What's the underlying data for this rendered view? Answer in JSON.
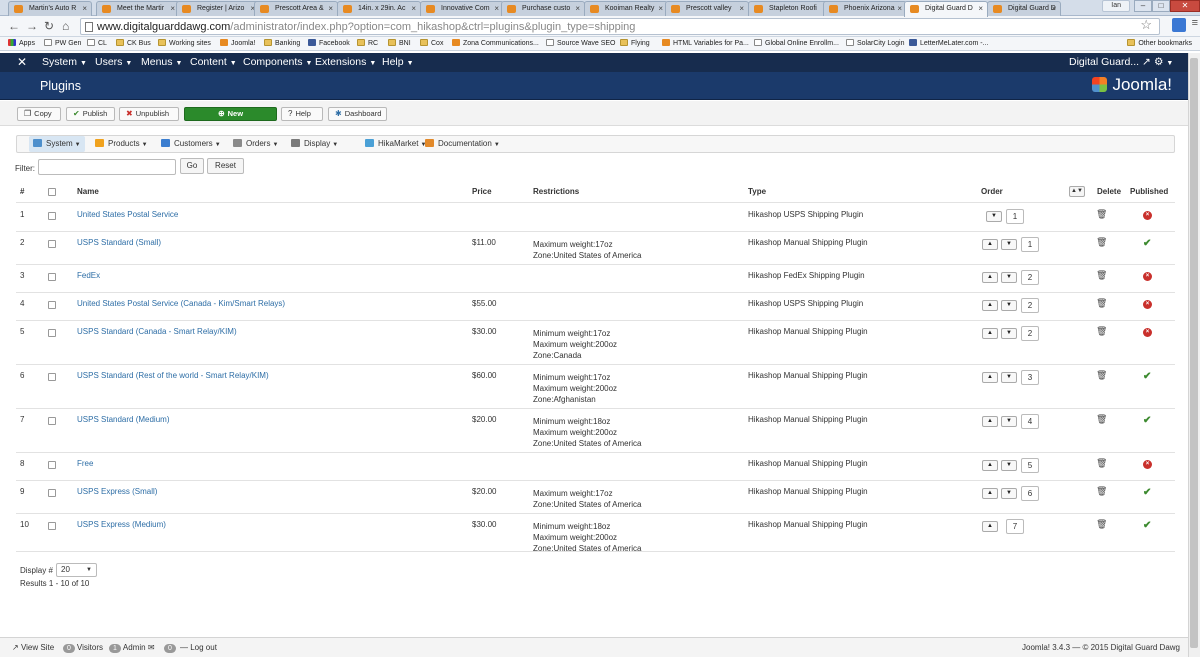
{
  "browser": {
    "tabs": [
      {
        "label": "Martin's Auto R"
      },
      {
        "label": "Meet the Martir"
      },
      {
        "label": "Register | Arizo"
      },
      {
        "label": "Prescott Area &"
      },
      {
        "label": "14in. x 29in. Ac"
      },
      {
        "label": "Innovative Com"
      },
      {
        "label": "Purchase custo"
      },
      {
        "label": "Kooiman Realty"
      },
      {
        "label": "Prescott valley"
      },
      {
        "label": "Stapleton Roofi"
      },
      {
        "label": "Phoenix Arizona"
      },
      {
        "label": "Digital Guard D"
      },
      {
        "label": "Digital Guard D"
      }
    ],
    "user": "Ian",
    "url_host": "www.digitalguarddawg.com",
    "url_path": "/administrator/index.php?option=com_hikashop&ctrl=plugins&plugin_type=shipping",
    "bookmarks": [
      {
        "label": "Apps",
        "icon": "apps-icon"
      },
      {
        "label": "PW Gen",
        "icon": "page-icon"
      },
      {
        "label": "CL",
        "icon": "peace-icon"
      },
      {
        "label": "CK Bus",
        "icon": "folder-icon"
      },
      {
        "label": "Working sites",
        "icon": "folder-icon"
      },
      {
        "label": "Joomla!",
        "icon": "joomla-icon"
      },
      {
        "label": "Banking",
        "icon": "folder-icon"
      },
      {
        "label": "Facebook",
        "icon": "facebook-icon"
      },
      {
        "label": "RC",
        "icon": "folder-icon"
      },
      {
        "label": "BNI",
        "icon": "folder-icon"
      },
      {
        "label": "Cox",
        "icon": "folder-icon"
      },
      {
        "label": "Zona Communications...",
        "icon": "zona-icon"
      },
      {
        "label": "Source Wave SEO",
        "icon": "page-icon"
      },
      {
        "label": "Flying",
        "icon": "folder-icon"
      },
      {
        "label": "HTML Variables for Pa...",
        "icon": "hikashop-icon"
      },
      {
        "label": "Global Online Enrollm...",
        "icon": "page-icon"
      },
      {
        "label": "SolarCity Login",
        "icon": "page-icon"
      },
      {
        "label": "LetterMeLater.com -...",
        "icon": "lml-icon"
      }
    ],
    "other_bookmarks": "Other bookmarks"
  },
  "admin_nav": {
    "items": [
      "System",
      "Users",
      "Menus",
      "Content",
      "Components",
      "Extensions",
      "Help"
    ],
    "site_name": "Digital Guard...",
    "brand": "Joomla!"
  },
  "page_title": "Plugins",
  "toolbar": {
    "copy": "Copy",
    "publish": "Publish",
    "unpublish": "Unpublish",
    "new": "New",
    "help": "Help",
    "dashboard": "Dashboard"
  },
  "hika_menu": [
    "System",
    "Products",
    "Customers",
    "Orders",
    "Display",
    "HikaMarket",
    "Documentation"
  ],
  "filter": {
    "label": "Filter:",
    "value": "",
    "go": "Go",
    "reset": "Reset"
  },
  "table": {
    "headers": {
      "num": "#",
      "name": "Name",
      "price": "Price",
      "restrictions": "Restrictions",
      "type": "Type",
      "order": "Order",
      "delete": "Delete",
      "published": "Published"
    },
    "rows": [
      {
        "num": "1",
        "name": "United States Postal Service",
        "price": "",
        "restrictions": [],
        "type": "Hikashop USPS Shipping Plugin",
        "order": "1",
        "published": false
      },
      {
        "num": "2",
        "name": "USPS Standard (Small)",
        "price": "$11.00",
        "restrictions": [
          "Maximum weight:17oz",
          "Zone:United States of America"
        ],
        "type": "Hikashop Manual Shipping Plugin",
        "order": "1",
        "published": true
      },
      {
        "num": "3",
        "name": "FedEx",
        "price": "",
        "restrictions": [],
        "type": "Hikashop FedEx Shipping Plugin",
        "order": "2",
        "published": false
      },
      {
        "num": "4",
        "name": "United States Postal Service (Canada - Kim/Smart Relays)",
        "price": "$55.00",
        "restrictions": [],
        "type": "Hikashop USPS Shipping Plugin",
        "order": "2",
        "published": false
      },
      {
        "num": "5",
        "name": "USPS Standard (Canada - Smart Relay/KIM)",
        "price": "$30.00",
        "restrictions": [
          "Minimum weight:17oz",
          "Maximum weight:200oz",
          "Zone:Canada"
        ],
        "type": "Hikashop Manual Shipping Plugin",
        "order": "2",
        "published": false
      },
      {
        "num": "6",
        "name": "USPS Standard (Rest of the world - Smart Relay/KIM)",
        "price": "$60.00",
        "restrictions": [
          "Minimum weight:17oz",
          "Maximum weight:200oz",
          "Zone:Afghanistan"
        ],
        "type": "Hikashop Manual Shipping Plugin",
        "order": "3",
        "published": true
      },
      {
        "num": "7",
        "name": "USPS Standard (Medium)",
        "price": "$20.00",
        "restrictions": [
          "Minimum weight:18oz",
          "Maximum weight:200oz",
          "Zone:United States of America"
        ],
        "type": "Hikashop Manual Shipping Plugin",
        "order": "4",
        "published": true
      },
      {
        "num": "8",
        "name": "Free",
        "price": "",
        "restrictions": [],
        "type": "Hikashop Manual Shipping Plugin",
        "order": "5",
        "published": false
      },
      {
        "num": "9",
        "name": "USPS Express (Small)",
        "price": "$20.00",
        "restrictions": [
          "Maximum weight:17oz",
          "Zone:United States of America"
        ],
        "type": "Hikashop Manual Shipping Plugin",
        "order": "6",
        "published": true
      },
      {
        "num": "10",
        "name": "USPS Express (Medium)",
        "price": "$30.00",
        "restrictions": [
          "Minimum weight:18oz",
          "Maximum weight:200oz",
          "Zone:United States of America"
        ],
        "type": "Hikashop Manual Shipping Plugin",
        "order": "7",
        "published": true
      }
    ]
  },
  "pagination": {
    "display_label": "Display #",
    "display_value": "20",
    "results": "Results 1 - 10 of 10"
  },
  "footer": {
    "view_site": "View Site",
    "visitors_count": "0",
    "visitors": "Visitors",
    "admin_count": "1",
    "admin": "Admin",
    "messages_count": "0",
    "logout": "Log out",
    "copyright": "Joomla! 3.4.3 — © 2015 Digital Guard Dawg"
  },
  "colors": {
    "navbar": "#172c4e",
    "subhead": "#1b3a6b",
    "new_button": "#2b8a2b",
    "link": "#2e6ea6",
    "published": "#3c8a2f",
    "unpublished": "#c9302c"
  }
}
